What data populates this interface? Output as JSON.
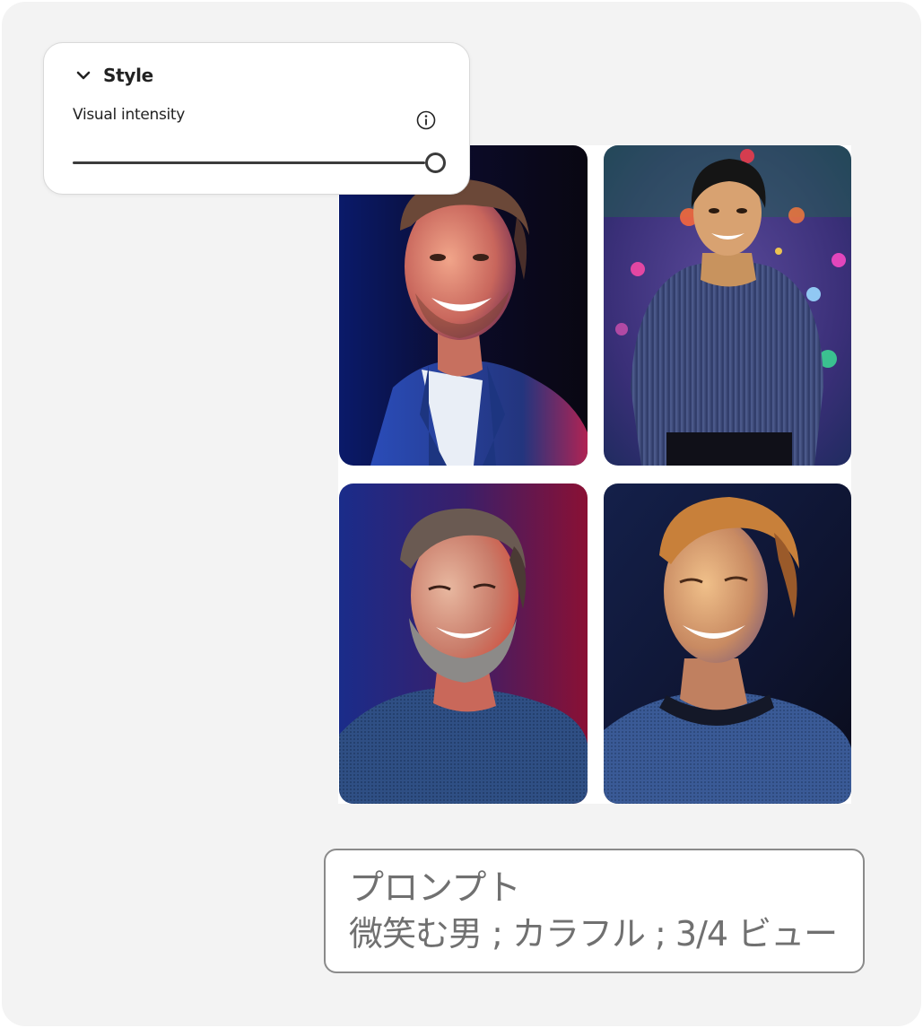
{
  "style_panel": {
    "title": "Style",
    "expanded": true,
    "visual_intensity": {
      "label": "Visual intensity",
      "value": 1.0,
      "info_icon": "info-icon"
    }
  },
  "image_grid": {
    "images": [
      {
        "name": "man-smiling-blue-blazer"
      },
      {
        "name": "man-striped-shirt-bokeh-lights"
      },
      {
        "name": "bearded-man-laughing-sweater"
      },
      {
        "name": "man-smiling-looking-up-sweater"
      }
    ]
  },
  "prompt": {
    "title": "プロンプト",
    "text": "微笑む男 ; カラフル ; 3/4 ビュー"
  },
  "colors": {
    "background": "#f3f3f3",
    "panel": "#ffffff",
    "text": "#222222",
    "prompt_text": "#707070"
  }
}
